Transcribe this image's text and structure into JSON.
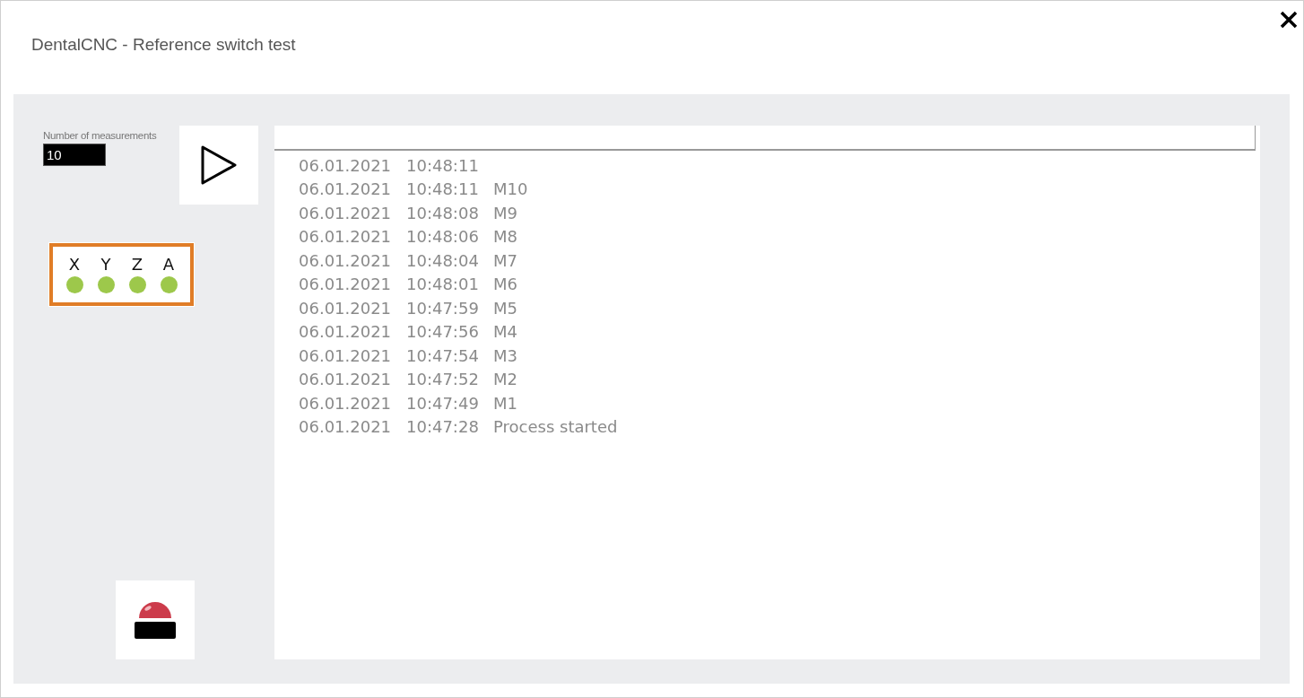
{
  "window": {
    "title": "DentalCNC - Reference switch test"
  },
  "measurements": {
    "label": "Number of measurements",
    "value": "10"
  },
  "axes": [
    {
      "label": "X",
      "on": true
    },
    {
      "label": "Y",
      "on": true
    },
    {
      "label": "Z",
      "on": true
    },
    {
      "label": "A",
      "on": true
    }
  ],
  "log": [
    {
      "date": "06.01.2021",
      "time": "10:48:11"
    },
    {
      "date": "06.01.2021",
      "time": "10:48:11",
      "message": "M10"
    },
    {
      "date": "06.01.2021",
      "time": "10:48:08",
      "message": "M9"
    },
    {
      "date": "06.01.2021",
      "time": "10:48:06",
      "message": "M8"
    },
    {
      "date": "06.01.2021",
      "time": "10:48:04",
      "message": "M7"
    },
    {
      "date": "06.01.2021",
      "time": "10:48:01",
      "message": "M6"
    },
    {
      "date": "06.01.2021",
      "time": "10:47:59",
      "message": "M5"
    },
    {
      "date": "06.01.2021",
      "time": "10:47:56",
      "message": "M4"
    },
    {
      "date": "06.01.2021",
      "time": "10:47:54",
      "message": "M3"
    },
    {
      "date": "06.01.2021",
      "time": "10:47:52",
      "message": "M2"
    },
    {
      "date": "06.01.2021",
      "time": "10:47:49",
      "message": "M1"
    },
    {
      "date": "06.01.2021",
      "time": "10:47:28",
      "message": "Process started"
    }
  ]
}
